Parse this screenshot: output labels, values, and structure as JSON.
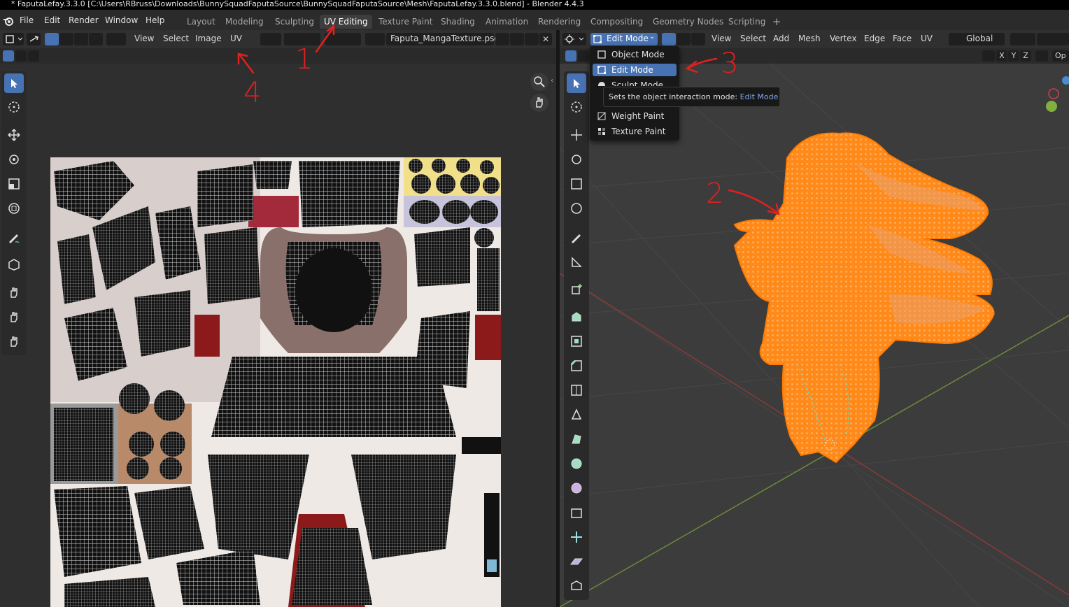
{
  "window": {
    "title": "* FaputaLefay.3.3.0 [C:\\Users\\RBruss\\Downloads\\BunnySquadFaputaSource\\BunnySquadFaputaSource\\Mesh\\FaputaLefay.3.3.0.blend] - Blender 4.4.3"
  },
  "menubar": {
    "items": [
      "File",
      "Edit",
      "Render",
      "Window",
      "Help"
    ]
  },
  "workspaces": {
    "tabs": [
      "Layout",
      "Modeling",
      "Sculpting",
      "UV Editing",
      "Texture Paint",
      "Shading",
      "Animation",
      "Rendering",
      "Compositing",
      "Geometry Nodes",
      "Scripting"
    ],
    "active": "UV Editing",
    "add_label": "+"
  },
  "uv_editor": {
    "menus": [
      "View",
      "Select",
      "Image",
      "UV"
    ],
    "image_name": "Faputa_MangaTexture.psd"
  },
  "viewport": {
    "mode_selected": "Edit Mode",
    "menus": [
      "View",
      "Select",
      "Add",
      "Mesh",
      "Vertex",
      "Edge",
      "Face",
      "UV"
    ],
    "transform_orientation": "Global",
    "axes": [
      "X",
      "Y",
      "Z"
    ],
    "overlay_label": "Op"
  },
  "mode_menu": {
    "items": [
      "Object Mode",
      "Edit Mode",
      "Sculpt Mode",
      "Weight Paint",
      "Texture Paint"
    ],
    "selected": "Edit Mode"
  },
  "tooltip": {
    "text": "Sets the object interaction mode: ",
    "highlight": "Edit Mode"
  },
  "annotations": [
    "1",
    "2",
    "3",
    "4"
  ],
  "colors": {
    "accent": "#4772b3",
    "mesh_orange": "#ff8a1a",
    "annotation_red": "#e02020",
    "viewport_bg": "#3c3c3c",
    "uv_bg": "#efe9e6"
  }
}
